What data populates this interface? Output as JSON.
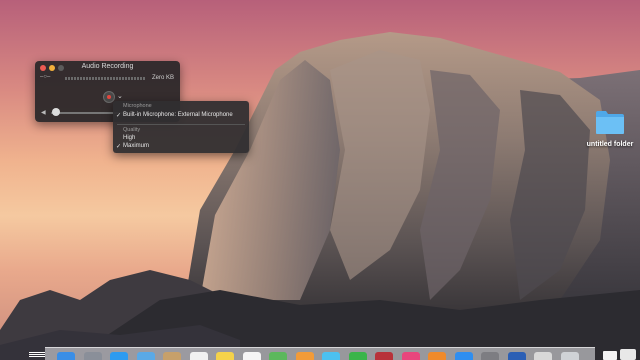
{
  "window": {
    "title": "Audio Recording",
    "file_size": "Zero KB",
    "level_icon": "–○–"
  },
  "menu": {
    "microphone_header": "Microphone",
    "microphone_item": "Built-in Microphone: External Microphone",
    "quality_header": "Quality",
    "quality_items": [
      "High",
      "Maximum"
    ],
    "check": "✓"
  },
  "desktop": {
    "folder_label": "untitled folder"
  },
  "dock": {
    "apps": [
      {
        "name": "finder-icon",
        "color": "#3a8ee6"
      },
      {
        "name": "launchpad-icon",
        "color": "#8a8f99"
      },
      {
        "name": "safari-icon",
        "color": "#2d9bf0"
      },
      {
        "name": "mail-icon",
        "color": "#5aa9e6"
      },
      {
        "name": "contacts-icon",
        "color": "#c7a06a"
      },
      {
        "name": "calendar-icon",
        "color": "#f1f1f1"
      },
      {
        "name": "notes-icon",
        "color": "#f5d24a"
      },
      {
        "name": "reminders-icon",
        "color": "#f5f5f5"
      },
      {
        "name": "maps-icon",
        "color": "#5cb85c"
      },
      {
        "name": "photos-icon",
        "color": "#f29b38"
      },
      {
        "name": "messages-icon",
        "color": "#4cc1f0"
      },
      {
        "name": "facetime-icon",
        "color": "#3ab54a"
      },
      {
        "name": "photo-booth-icon",
        "color": "#b8323a"
      },
      {
        "name": "itunes-icon",
        "color": "#e8467d"
      },
      {
        "name": "ibooks-icon",
        "color": "#f08a2a"
      },
      {
        "name": "app-store-icon",
        "color": "#2e8ef0"
      },
      {
        "name": "system-preferences-icon",
        "color": "#7d7d82"
      },
      {
        "name": "quicktime-icon",
        "color": "#2b5fb5"
      },
      {
        "name": "preview-icon",
        "color": "#d8d8d8"
      },
      {
        "name": "trash-icon",
        "color": "#cfd2d6"
      }
    ]
  }
}
